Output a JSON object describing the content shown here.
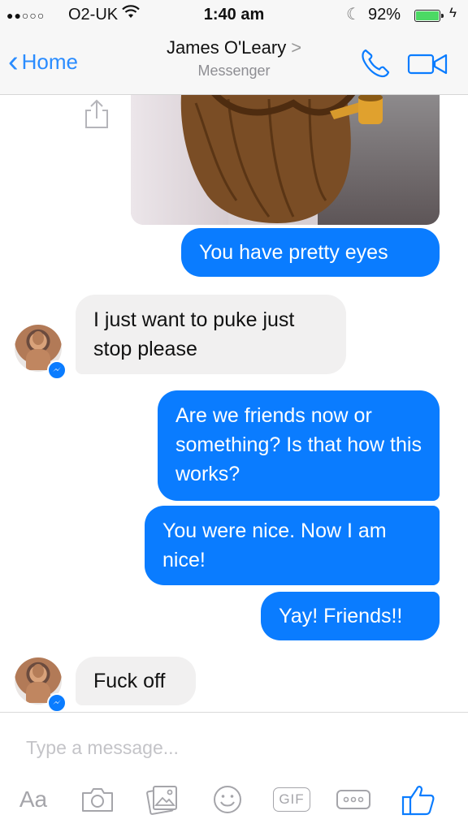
{
  "status_bar": {
    "signal": "●●○○○",
    "carrier": "O2-UK",
    "time": "1:40 am",
    "battery_percent": "92%",
    "battery_level": 0.92
  },
  "header": {
    "back_label": "Home",
    "contact_name": "James O'Leary",
    "title_chevron": ">",
    "subtitle": "Messenger"
  },
  "messages": [
    {
      "direction": "outgoing",
      "text": "You have pretty eyes"
    },
    {
      "direction": "incoming",
      "text": "I just want to puke just stop please"
    },
    {
      "direction": "outgoing",
      "text": "Are we friends now or something? Is that how this works?"
    },
    {
      "direction": "outgoing",
      "text": "You were nice. Now I am nice!"
    },
    {
      "direction": "outgoing",
      "text": "Yay! Friends!!"
    },
    {
      "direction": "incoming",
      "text": "Fuck off"
    }
  ],
  "composer": {
    "placeholder": "Type a message...",
    "aa_label": "Aa",
    "gif_label": "GIF"
  },
  "colors": {
    "accent": "#0a7cff",
    "incoming_bubble": "#f1f0f0",
    "nav_link": "#2a8cff"
  }
}
